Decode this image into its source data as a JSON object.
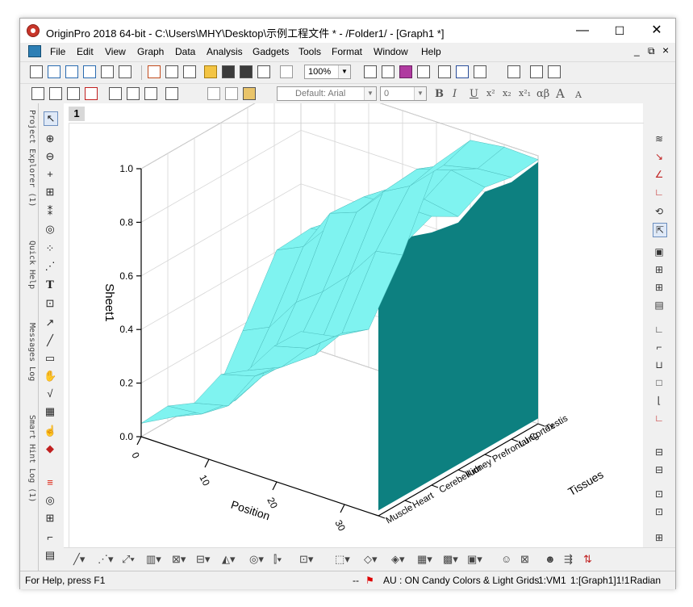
{
  "window": {
    "title": "OriginPro 2018 64-bit - C:\\Users\\MHY\\Desktop\\示例工程文件 * - /Folder1/ - [Graph1 *]",
    "minimize": "—",
    "maximize": "☐",
    "close": "✕"
  },
  "menu": {
    "items": [
      "File",
      "Edit",
      "View",
      "Graph",
      "Data",
      "Analysis",
      "Gadgets",
      "Tools",
      "Format",
      "Window",
      "Help"
    ],
    "mdi_min": "_",
    "mdi_restore": "⧉",
    "mdi_close": "×"
  },
  "toolbar": {
    "zoom": "100%",
    "font": "Default: Arial",
    "font_size": "0",
    "bold": "B",
    "italic": "I",
    "underline": "U",
    "superscript": "x²",
    "subscript": "x₂",
    "supsub": "x²₁",
    "greek": "αβ",
    "grow_font": "A",
    "shrink_font": "A"
  },
  "side_tabs": [
    "Project Explorer (1)",
    "Quick Help",
    "Messages Log",
    "Smart Hint Log (1)"
  ],
  "graph": {
    "page_number": "1",
    "chart_data": {
      "type": "3d-surface",
      "zlabel": "Sheet1",
      "xlabel": "Position",
      "ylabel": "Tissues",
      "z_ticks": [
        "0.0",
        "0.2",
        "0.4",
        "0.6",
        "0.8",
        "1.0"
      ],
      "zlim": [
        0,
        1
      ],
      "x_ticks": [
        "0",
        "10",
        "20",
        "30"
      ],
      "y_ticks": [
        "Muscle",
        "Heart",
        "Cerebellum",
        "Kidney",
        "Prefrontal Cortex",
        "Lung",
        "Testis"
      ],
      "surface_color": "#7ff3f0",
      "side_color": "#0d8080",
      "profile_positions": [
        0,
        5,
        10,
        15,
        20,
        25,
        30,
        35
      ],
      "profile_values": [
        0.05,
        0.08,
        0.18,
        0.5,
        0.85,
        0.97,
        0.98,
        0.98
      ],
      "grid": true
    }
  },
  "status": {
    "help": "For Help, press F1",
    "dashes": "--",
    "au": "AU : ON",
    "theme": "Candy Colors & Light Grids",
    "vm": "1:VM1",
    "graph_ref": "1:[Graph1]1!1",
    "unit": "Radian"
  }
}
